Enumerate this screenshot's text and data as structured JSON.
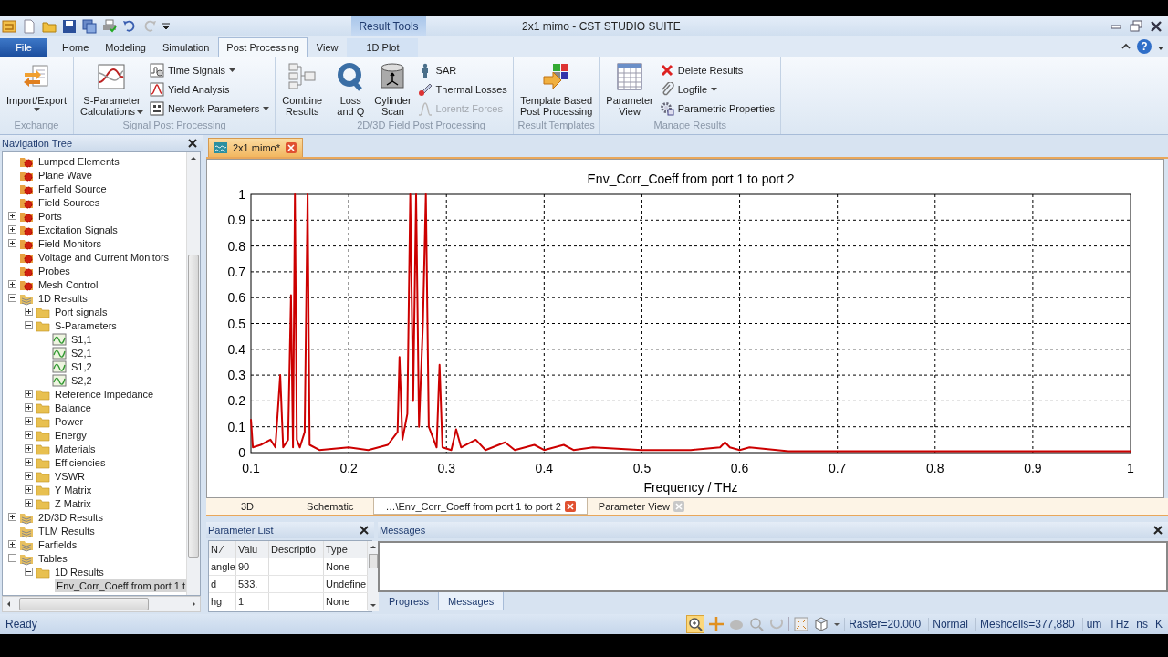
{
  "window": {
    "title": "2x1 mimo - CST STUDIO SUITE"
  },
  "ribbon": {
    "contextual_label": "Result Tools",
    "help": "?",
    "tabs": [
      {
        "label": "File",
        "kind": "file",
        "selected": false
      },
      {
        "label": "Home",
        "kind": "normal",
        "selected": false
      },
      {
        "label": "Modeling",
        "kind": "normal",
        "selected": false
      },
      {
        "label": "Simulation",
        "kind": "normal",
        "selected": false
      },
      {
        "label": "Post Processing",
        "kind": "normal",
        "selected": true
      },
      {
        "label": "View",
        "kind": "normal",
        "selected": false
      },
      {
        "label": "1D Plot",
        "kind": "contextual",
        "selected": false
      }
    ],
    "groups": [
      {
        "label": "Exchange",
        "items": [
          {
            "kind": "large",
            "lines": [
              "Import/Export"
            ],
            "dropdown": true
          }
        ]
      },
      {
        "label": "Signal Post Processing",
        "items": [
          {
            "kind": "large",
            "lines": [
              "S-Parameter",
              "Calculations"
            ],
            "dropdown": true
          },
          {
            "kind": "stack",
            "items": [
              {
                "label": "Time Signals",
                "dropdown": true,
                "disabled": false
              },
              {
                "label": "Yield Analysis",
                "dropdown": false,
                "disabled": false
              },
              {
                "label": "Network Parameters",
                "dropdown": true,
                "disabled": false
              }
            ]
          }
        ]
      },
      {
        "items": [
          {
            "kind": "large",
            "lines": [
              "Combine",
              "Results"
            ],
            "dropdown": false
          }
        ]
      },
      {
        "label": "2D/3D Field Post Processing",
        "items": [
          {
            "kind": "large",
            "lines": [
              "Loss",
              "and Q"
            ],
            "dropdown": false
          },
          {
            "kind": "large",
            "lines": [
              "Cylinder",
              "Scan"
            ],
            "dropdown": false
          },
          {
            "kind": "stack",
            "items": [
              {
                "label": "SAR",
                "dropdown": false,
                "disabled": false
              },
              {
                "label": "Thermal Losses",
                "dropdown": false,
                "disabled": false
              },
              {
                "label": "Lorentz Forces",
                "dropdown": false,
                "disabled": true
              }
            ]
          }
        ]
      },
      {
        "label": "Result Templates",
        "items": [
          {
            "kind": "large",
            "lines": [
              "Template Based",
              "Post Processing"
            ],
            "dropdown": false
          }
        ]
      },
      {
        "label": "Manage Results",
        "items": [
          {
            "kind": "large",
            "lines": [
              "Parameter",
              "View"
            ],
            "dropdown": false
          },
          {
            "kind": "stack",
            "items": [
              {
                "label": "Delete Results",
                "dropdown": false,
                "disabled": false
              },
              {
                "label": "Logfile",
                "dropdown": true,
                "disabled": false
              },
              {
                "label": "Parametric Properties",
                "dropdown": false,
                "disabled": false
              }
            ]
          }
        ]
      }
    ]
  },
  "nav_tree": {
    "title": "Navigation Tree",
    "items": [
      {
        "label": "Lumped Elements",
        "kind": "source",
        "selected": false
      },
      {
        "label": "Plane Wave",
        "kind": "source",
        "selected": false
      },
      {
        "label": "Farfield Source",
        "kind": "source",
        "selected": false
      },
      {
        "label": "Field Sources",
        "kind": "source",
        "selected": false
      },
      {
        "label": "Ports",
        "kind": "source",
        "expanded": false,
        "selected": false
      },
      {
        "label": "Excitation Signals",
        "kind": "source",
        "expanded": false,
        "selected": false
      },
      {
        "label": "Field Monitors",
        "kind": "source",
        "expanded": false,
        "selected": false
      },
      {
        "label": "Voltage and Current Monitors",
        "kind": "source",
        "selected": false
      },
      {
        "label": "Probes",
        "kind": "source",
        "selected": false
      },
      {
        "label": "Mesh Control",
        "kind": "source",
        "expanded": false,
        "selected": false
      },
      {
        "label": "1D Results",
        "kind": "results",
        "expanded": true,
        "selected": false,
        "children": [
          {
            "label": "Port signals",
            "kind": "folder",
            "expanded": false,
            "selected": false
          },
          {
            "label": "S-Parameters",
            "kind": "folder",
            "expanded": true,
            "selected": false,
            "children": [
              {
                "label": "S1,1",
                "kind": "curve",
                "selected": false
              },
              {
                "label": "S2,1",
                "kind": "curve",
                "selected": false
              },
              {
                "label": "S1,2",
                "kind": "curve",
                "selected": false
              },
              {
                "label": "S2,2",
                "kind": "curve",
                "selected": false
              }
            ]
          },
          {
            "label": "Reference Impedance",
            "kind": "folder",
            "expanded": false,
            "selected": false
          },
          {
            "label": "Balance",
            "kind": "folder",
            "expanded": false,
            "selected": false
          },
          {
            "label": "Power",
            "kind": "folder",
            "expanded": false,
            "selected": false
          },
          {
            "label": "Energy",
            "kind": "folder",
            "expanded": false,
            "selected": false
          },
          {
            "label": "Materials",
            "kind": "folder",
            "expanded": false,
            "selected": false
          },
          {
            "label": "Efficiencies",
            "kind": "folder",
            "expanded": false,
            "selected": false
          },
          {
            "label": "VSWR",
            "kind": "folder",
            "expanded": false,
            "selected": false
          },
          {
            "label": "Y Matrix",
            "kind": "folder",
            "expanded": false,
            "selected": false
          },
          {
            "label": "Z Matrix",
            "kind": "folder",
            "expanded": false,
            "selected": false
          }
        ]
      },
      {
        "label": "2D/3D Results",
        "kind": "results",
        "expanded": false,
        "selected": false
      },
      {
        "label": "TLM Results",
        "kind": "results",
        "selected": false
      },
      {
        "label": "Farfields",
        "kind": "results",
        "expanded": false,
        "selected": false
      },
      {
        "label": "Tables",
        "kind": "results",
        "expanded": true,
        "selected": false,
        "children": [
          {
            "label": "1D Results",
            "kind": "folder",
            "expanded": true,
            "selected": false,
            "children": [
              {
                "label": "Env_Corr_Coeff from port 1 t",
                "kind": "curve",
                "selected": true
              }
            ]
          }
        ]
      }
    ]
  },
  "document_tab": {
    "label": "2x1 mimo*"
  },
  "chart": {
    "chart_data": {
      "type": "line",
      "grid": true,
      "title": "Env_Corr_Coeff from port 1 to port 2",
      "xlabel": "Frequency / THz",
      "xlim": [
        0.1,
        1
      ],
      "ylim": [
        0,
        1
      ],
      "xticks": [
        0.1,
        0.2,
        0.3,
        0.4,
        0.5,
        0.6,
        0.7,
        0.8,
        0.9,
        1
      ],
      "yticks": [
        0,
        0.1,
        0.2,
        0.3,
        0.4,
        0.5,
        0.6,
        0.7,
        0.8,
        0.9,
        1
      ],
      "x": [
        0.1,
        0.102,
        0.11,
        0.12,
        0.125,
        0.13,
        0.133,
        0.138,
        0.141,
        0.143,
        0.145,
        0.147,
        0.15,
        0.155,
        0.158,
        0.16,
        0.17,
        0.2,
        0.22,
        0.24,
        0.25,
        0.252,
        0.255,
        0.26,
        0.263,
        0.266,
        0.269,
        0.272,
        0.276,
        0.279,
        0.282,
        0.29,
        0.293,
        0.296,
        0.305,
        0.31,
        0.315,
        0.33,
        0.34,
        0.36,
        0.37,
        0.39,
        0.4,
        0.42,
        0.43,
        0.45,
        0.5,
        0.55,
        0.58,
        0.585,
        0.59,
        0.6,
        0.61,
        0.65,
        0.8,
        1
      ],
      "series": [
        {
          "color": "#cc0000",
          "values": [
            0.13,
            0.02,
            0.03,
            0.05,
            0.02,
            0.3,
            0.02,
            0.05,
            0.61,
            0.02,
            1,
            0.05,
            0.02,
            0.08,
            1,
            0.03,
            0.01,
            0.02,
            0.01,
            0.03,
            0.08,
            0.37,
            0.05,
            0.15,
            1,
            0.2,
            1,
            0.1,
            0.5,
            1,
            0.1,
            0.02,
            0.34,
            0.02,
            0.01,
            0.09,
            0.02,
            0.05,
            0.01,
            0.04,
            0.01,
            0.03,
            0.01,
            0.03,
            0.01,
            0.02,
            0.01,
            0.01,
            0.02,
            0.04,
            0.02,
            0.01,
            0.02,
            0.005,
            0.005,
            0.005
          ]
        }
      ]
    }
  },
  "view_tabs": [
    {
      "label": "3D",
      "selected": false,
      "closable": false
    },
    {
      "label": "Schematic",
      "selected": false,
      "closable": false
    },
    {
      "label": "…\\Env_Corr_Coeff from port 1 to port 2",
      "selected": true,
      "closable": true
    },
    {
      "label": "Parameter View",
      "selected": false,
      "closable": true
    }
  ],
  "parameter_list": {
    "title": "Parameter List",
    "columns": [
      "N ⁄",
      "Valu",
      "Descriptio",
      "Type"
    ],
    "rows": [
      [
        "angle",
        "90",
        "",
        "None"
      ],
      [
        "d",
        "533.",
        "",
        "Undefine"
      ],
      [
        "hg",
        "1",
        "",
        "None"
      ]
    ]
  },
  "messages": {
    "title": "Messages",
    "tabs": [
      {
        "label": "Progress",
        "selected": false
      },
      {
        "label": "Messages",
        "selected": true
      }
    ]
  },
  "status_bar": {
    "status": "Ready",
    "fields": [
      "Raster=20.000",
      "Normal",
      "Meshcells=377,880"
    ],
    "units": [
      "um",
      "THz",
      "ns",
      "K"
    ]
  }
}
